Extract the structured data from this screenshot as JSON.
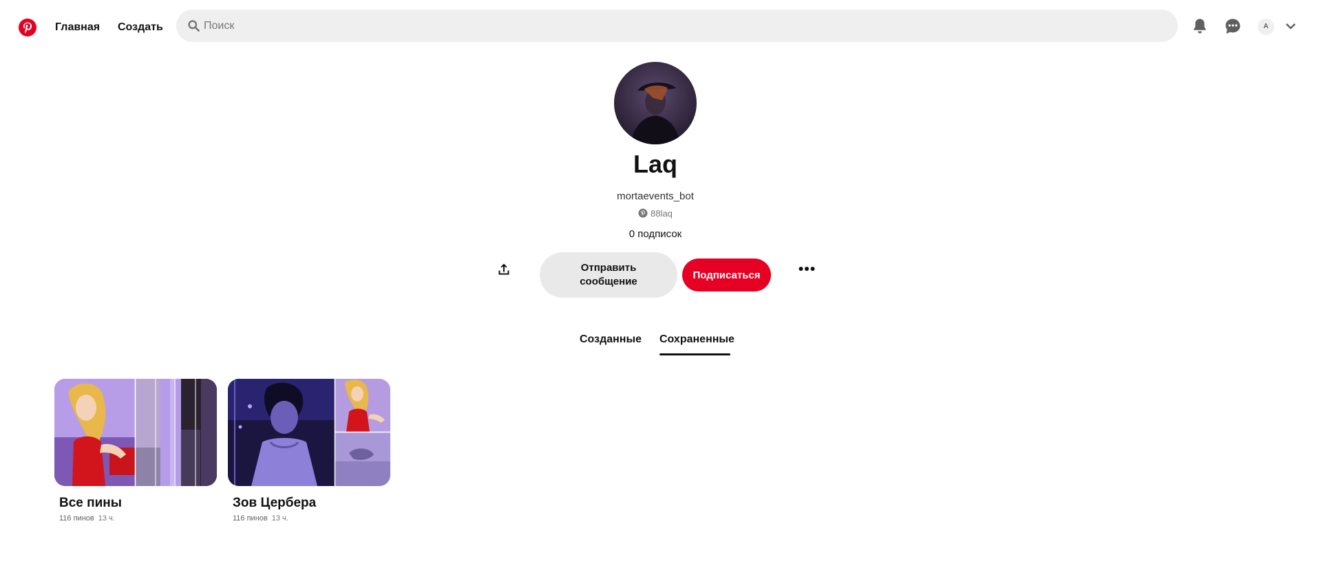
{
  "header": {
    "logo_icon": "pinterest-logo-icon",
    "nav": {
      "home_label": "Главная",
      "create_label": "Создать"
    },
    "search": {
      "placeholder": "Поиск",
      "value": ""
    },
    "icons": [
      "bell-icon",
      "chat-icon",
      "chevron-down-icon"
    ],
    "user_initial": "A",
    "brand_color": "#e60023"
  },
  "profile": {
    "name": "Laq",
    "username": "mortaevents_bot",
    "pinterest_handle": "88laq",
    "following": "0 подписок",
    "message_label": "Отправить сообщение",
    "follow_label": "Подписаться"
  },
  "tabs": {
    "created_label": "Созданные",
    "saved_label": "Сохраненные",
    "active": "Сохраненные"
  },
  "boards": [
    {
      "title": "Все пины",
      "pins": "116 пинов",
      "time": "13 ч."
    },
    {
      "title": "Зов Цербера",
      "pins": "116 пинов",
      "time": "13 ч."
    }
  ]
}
